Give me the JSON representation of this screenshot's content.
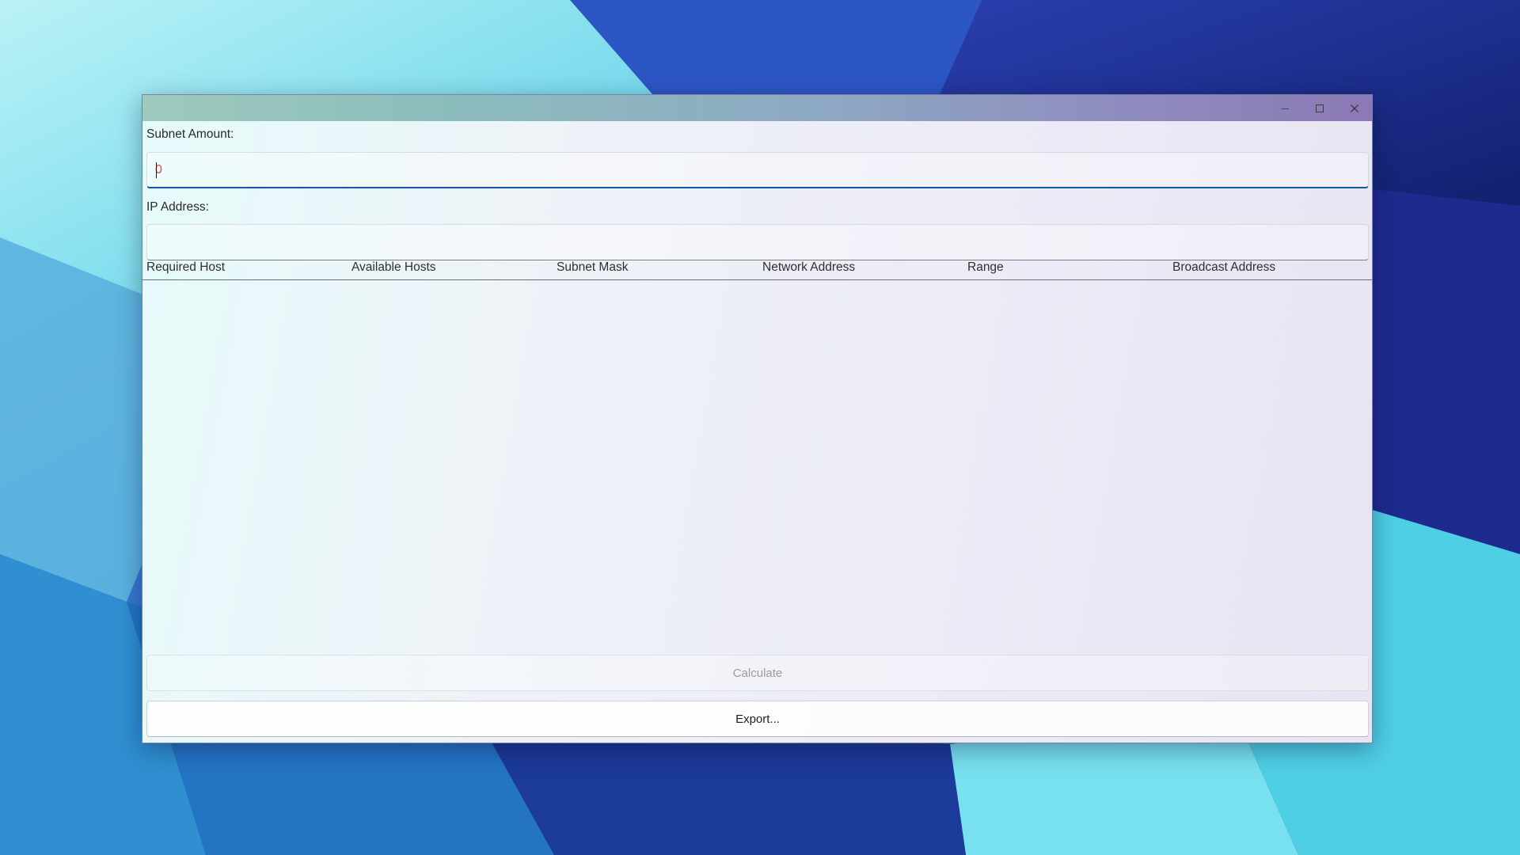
{
  "window": {
    "title": "",
    "controls": {
      "minimize_icon": "minimize-icon",
      "maximize_icon": "maximize-icon",
      "close_icon": "close-icon"
    }
  },
  "form": {
    "subnet_amount": {
      "label": "Subnet Amount:",
      "value": "0"
    },
    "ip_address": {
      "label": "IP Address:",
      "value": ""
    }
  },
  "table": {
    "columns": [
      "Required Host",
      "Available Hosts",
      "Subnet Mask",
      "Network Address",
      "Range",
      "Broadcast Address"
    ],
    "rows": []
  },
  "buttons": {
    "calculate": "Calculate",
    "export": "Export..."
  },
  "colors": {
    "input_text": "#d64a4a",
    "focus_accent": "#0f5a9e",
    "disabled_text": "#9a9aa0"
  }
}
